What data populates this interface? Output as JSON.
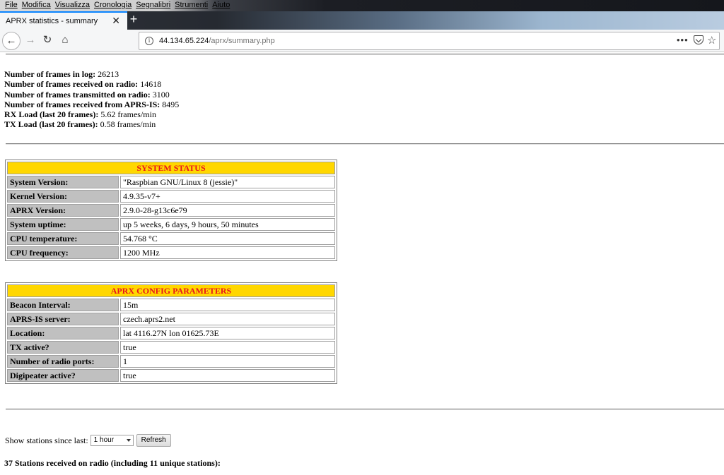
{
  "browser": {
    "menu": [
      "File",
      "Modifica",
      "Visualizza",
      "Cronologia",
      "Segnalibri",
      "Strumenti",
      "Aiuto"
    ],
    "tab_title": "APRX statistics - summary",
    "tab_close": "✕",
    "new_tab": "+",
    "url_host": "44.134.65.224",
    "url_path": "/aprx/summary.php",
    "more_menu": "•••"
  },
  "summary": {
    "frames_log_label": "Number of frames in log:",
    "frames_log_value": "26213",
    "frames_rx_label": "Number of frames received on radio:",
    "frames_rx_value": "14618",
    "frames_tx_label": "Number of frames transmitted on radio:",
    "frames_tx_value": "3100",
    "frames_is_label": "Number of frames received from APRS-IS:",
    "frames_is_value": "8495",
    "rx_load_label": "RX Load (last 20 frames):",
    "rx_load_value": "5.62 frames/min",
    "tx_load_label": "TX Load (last 20 frames):",
    "tx_load_value": "0.58 frames/min"
  },
  "system_status": {
    "title": "SYSTEM STATUS",
    "rows": [
      {
        "label": "System Version:",
        "value": "\"Raspbian GNU/Linux 8 (jessie)\""
      },
      {
        "label": "Kernel Version:",
        "value": "4.9.35-v7+"
      },
      {
        "label": "APRX Version:",
        "value": "2.9.0-28-g13c6e79"
      },
      {
        "label": "System uptime:",
        "value": "up 5 weeks, 6 days, 9 hours, 50 minutes"
      },
      {
        "label": "CPU temperature:",
        "value": "54.768 °C"
      },
      {
        "label": "CPU frequency:",
        "value": "1200 MHz"
      }
    ]
  },
  "config": {
    "title": "APRX CONFIG PARAMETERS",
    "rows": [
      {
        "label": "Beacon Interval:",
        "value": "15m"
      },
      {
        "label": "APRS-IS server:",
        "value": "czech.aprs2.net"
      },
      {
        "label": "Location:",
        "value": "lat 4116.27N lon 01625.73E"
      },
      {
        "label": "TX active?",
        "value": "true"
      },
      {
        "label": "Number of radio ports:",
        "value": "1"
      },
      {
        "label": "Digipeater active?",
        "value": "true"
      }
    ]
  },
  "stations": {
    "show_label": "Show stations since last:",
    "select_value": "1 hour",
    "refresh_label": "Refresh",
    "count_text": "37 Stations received on radio (including 11 unique stations):"
  }
}
